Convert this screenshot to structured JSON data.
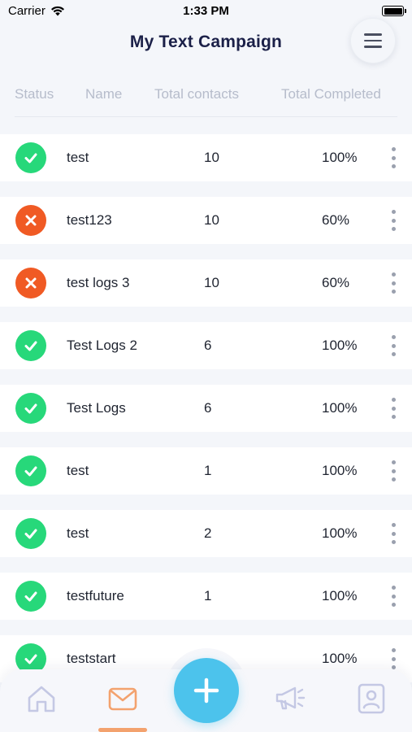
{
  "status_bar": {
    "carrier": "Carrier",
    "time": "1:33 PM"
  },
  "header": {
    "title": "My Text Campaign",
    "menu_icon": "hamburger-icon"
  },
  "columns": {
    "status": "Status",
    "name": "Name",
    "contacts": "Total contacts",
    "completed": "Total Completed"
  },
  "colors": {
    "success": "#27d87a",
    "failure": "#f05a24",
    "accent": "#4cc3ec",
    "active_tab": "#f3a26e",
    "title": "#1b2048"
  },
  "campaigns": [
    {
      "status": "success",
      "name": "test",
      "contacts": "10",
      "completed": "100%"
    },
    {
      "status": "failure",
      "name": "test123",
      "contacts": "10",
      "completed": "60%"
    },
    {
      "status": "failure",
      "name": "test logs 3",
      "contacts": "10",
      "completed": "60%"
    },
    {
      "status": "success",
      "name": "Test Logs 2",
      "contacts": "6",
      "completed": "100%"
    },
    {
      "status": "success",
      "name": "Test Logs",
      "contacts": "6",
      "completed": "100%"
    },
    {
      "status": "success",
      "name": "test",
      "contacts": "1",
      "completed": "100%"
    },
    {
      "status": "success",
      "name": "test",
      "contacts": "2",
      "completed": "100%"
    },
    {
      "status": "success",
      "name": "testfuture",
      "contacts": "1",
      "completed": "100%"
    },
    {
      "status": "success",
      "name": "teststart",
      "contacts": "",
      "completed": "100%"
    }
  ],
  "tabbar": {
    "items": [
      "home-icon",
      "mail-icon",
      "add-icon",
      "megaphone-icon",
      "profile-icon"
    ],
    "active": "mail-icon"
  }
}
